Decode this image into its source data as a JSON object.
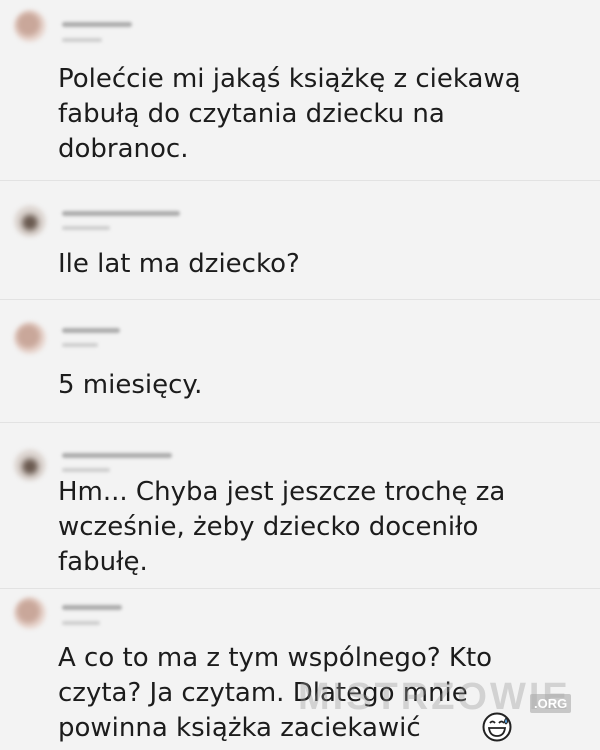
{
  "posts": [
    {
      "text": "Polećcie mi jakąś książkę z ciekawą\nfabułą do czytania dziecku na\ndobranoc."
    },
    {
      "text": "Ile lat ma dziecko?"
    },
    {
      "text": "5 miesięcy."
    },
    {
      "text": "Hm... Chyba jest jeszcze trochę za\nwcześnie, żeby dziecko doceniło\nfabułę."
    },
    {
      "text": "A co to ma z tym wspólnego? Kto\nczyta? Ja czytam. Dlatego mnie\npowinna książka zaciekawić"
    }
  ],
  "watermark": {
    "text": "MISTRZOWIE",
    "badge": ".ORG"
  },
  "emoji": "grinning-sweat-emoji"
}
